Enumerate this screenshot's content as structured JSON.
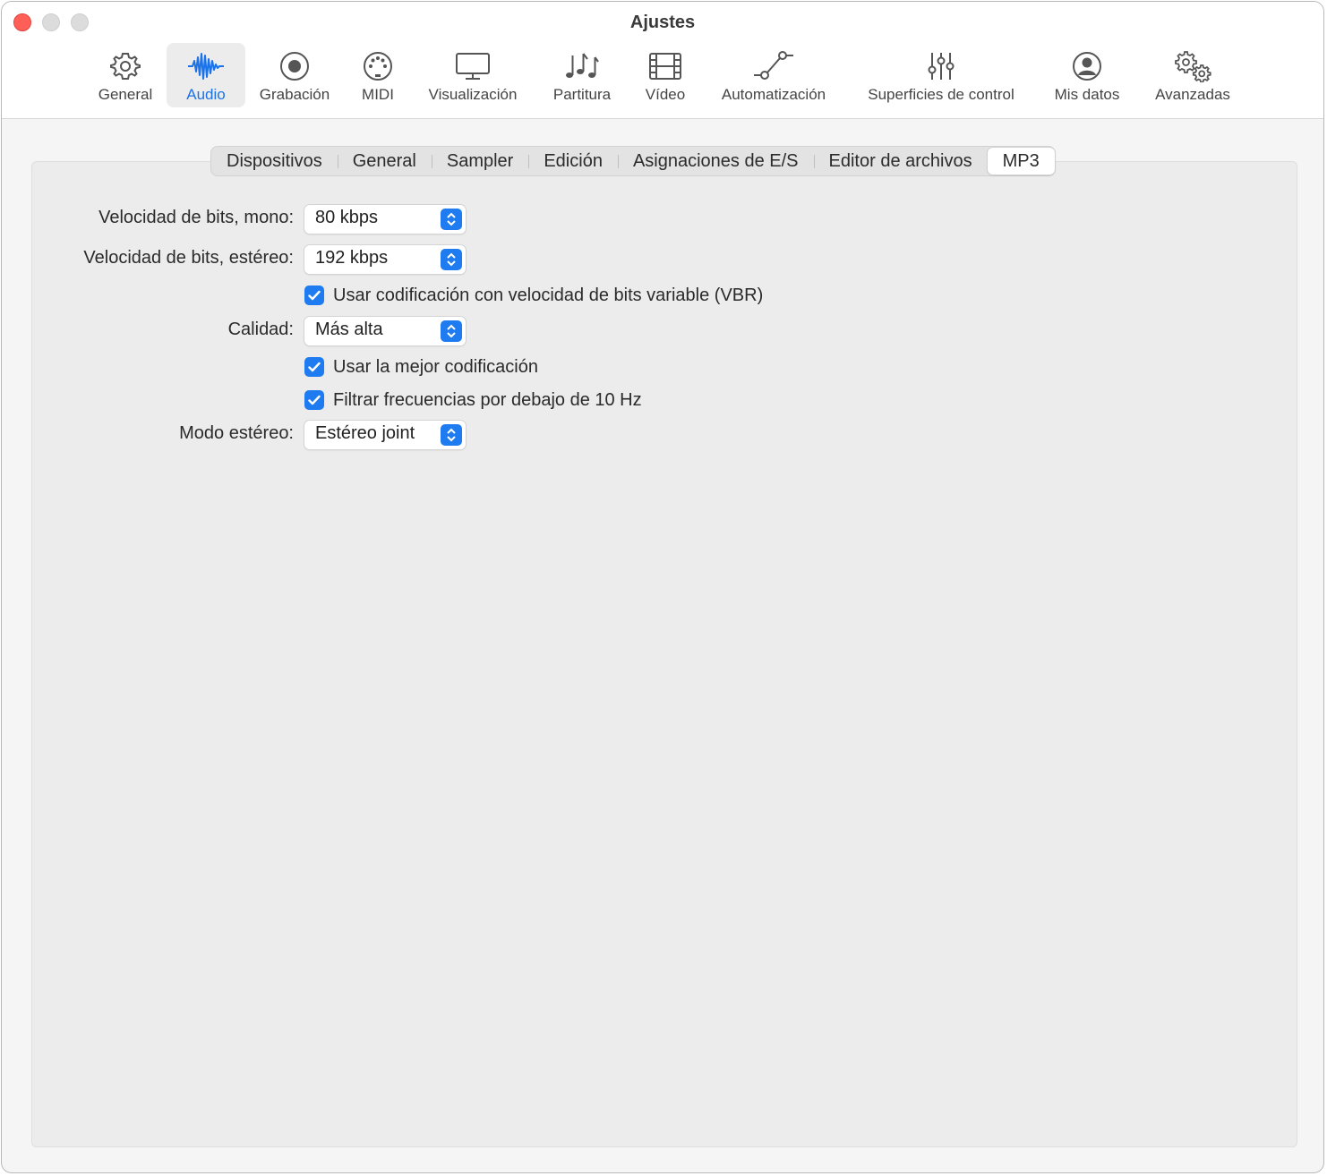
{
  "window": {
    "title": "Ajustes"
  },
  "toolbar": [
    {
      "id": "general",
      "label": "General",
      "icon": "gear-icon"
    },
    {
      "id": "audio",
      "label": "Audio",
      "icon": "waveform-icon",
      "selected": true
    },
    {
      "id": "grabacion",
      "label": "Grabación",
      "icon": "record-icon"
    },
    {
      "id": "midi",
      "label": "MIDI",
      "icon": "midi-port-icon"
    },
    {
      "id": "visualizacion",
      "label": "Visualización",
      "icon": "display-icon"
    },
    {
      "id": "partitura",
      "label": "Partitura",
      "icon": "music-notes-icon"
    },
    {
      "id": "video",
      "label": "Vídeo",
      "icon": "film-icon"
    },
    {
      "id": "automatizacion",
      "label": "Automatización",
      "icon": "automation-icon"
    },
    {
      "id": "superficies",
      "label": "Superficies de control",
      "icon": "sliders-icon"
    },
    {
      "id": "misdatos",
      "label": "Mis datos",
      "icon": "person-icon"
    },
    {
      "id": "avanzadas",
      "label": "Avanzadas",
      "icon": "gears-icon"
    }
  ],
  "tabs": [
    {
      "label": "Dispositivos"
    },
    {
      "label": "General"
    },
    {
      "label": "Sampler"
    },
    {
      "label": "Edición"
    },
    {
      "label": "Asignaciones de E/S"
    },
    {
      "label": "Editor de archivos"
    },
    {
      "label": "MP3",
      "active": true
    }
  ],
  "form": {
    "mono_label": "Velocidad de bits, mono:",
    "mono_value": "80 kbps",
    "stereo_label": "Velocidad de bits, estéreo:",
    "stereo_value": "192 kbps",
    "vbr_label": "Usar codificación con velocidad de bits variable (VBR)",
    "vbr_checked": true,
    "quality_label": "Calidad:",
    "quality_value": "Más alta",
    "best_label": "Usar la mejor codificación",
    "best_checked": true,
    "filter_label": "Filtrar frecuencias por debajo de 10 Hz",
    "filter_checked": true,
    "mode_label": "Modo estéreo:",
    "mode_value": "Estéreo joint"
  },
  "colors": {
    "accent": "#1f7bf0",
    "close": "#ff5f57"
  }
}
